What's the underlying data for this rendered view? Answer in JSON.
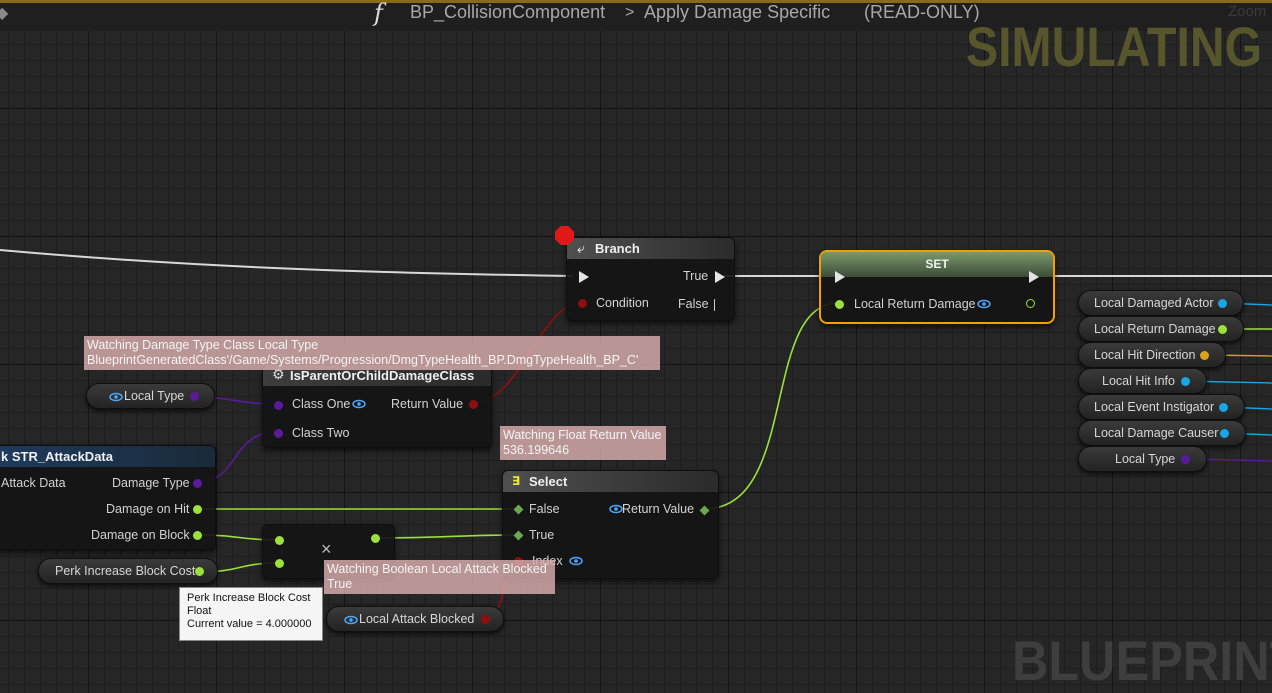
{
  "topbar": {
    "breadcrumb_parent": "BP_CollisionComponent",
    "breadcrumb_sep": ">",
    "breadcrumb_current": "Apply Damage Specific",
    "readonly_tag": "(READ-ONLY)",
    "zoom_label": "Zoom"
  },
  "watermarks": {
    "simulating": "SIMULATING",
    "blueprint": "BLUEPRINT"
  },
  "nodes": {
    "branch": {
      "title": "Branch",
      "true_label": "True",
      "false_label": "False",
      "condition_label": "Condition"
    },
    "set": {
      "title": "SET",
      "pin_label": "Local Return Damage"
    },
    "is_parent": {
      "title": "IsParentOrChildDamageClass",
      "class_one": "Class One",
      "class_two": "Class Two",
      "return_value": "Return Value"
    },
    "break_struct": {
      "title": "k STR_AttackData",
      "attack_data": "Attack Data",
      "damage_type": "Damage Type",
      "damage_on_hit": "Damage on Hit",
      "damage_on_block": "Damage on Block"
    },
    "select": {
      "title": "Select",
      "false_label": "False",
      "true_label": "True",
      "index_label": "Index",
      "return_value": "Return Value"
    },
    "multiply": {
      "symbol": "×"
    }
  },
  "variables": {
    "local_type_left": "Local Type",
    "perk_increase_block_cost": "Perk Increase Block Cost",
    "local_attack_blocked": "Local Attack Blocked",
    "right_column": [
      "Local Damaged Actor",
      "Local Return Damage",
      "Local Hit Direction",
      "Local Hit Info",
      "Local Event Instigator",
      "Local Damage Causer",
      "Local Type"
    ]
  },
  "watches": {
    "damage_type": {
      "line1": "Watching Damage Type Class Local Type",
      "line2": "BlueprintGeneratedClass'/Game/Systems/Progression/DmgTypeHealth_BP.DmgTypeHealth_BP_C'"
    },
    "float_return": {
      "line1": "Watching Float Return Value",
      "line2": "536.199646"
    },
    "boolean": {
      "line1": "Watching Boolean Local Attack Blocked",
      "line2": "True"
    }
  },
  "tooltip": {
    "line1": "Perk Increase Block Cost",
    "line2": "Float",
    "line3": "Current value = 4.000000"
  },
  "colors": {
    "exec": "#e4e4e4",
    "float_pin": "#9be03c",
    "bool_pin": "#8d0f0f",
    "class_pin": "#5a1a9a",
    "object_pin": "#1aa5e6",
    "struct_pin": "#d9a21a",
    "set_border": "#f0a000",
    "accent_bar": "#8a6a16"
  }
}
